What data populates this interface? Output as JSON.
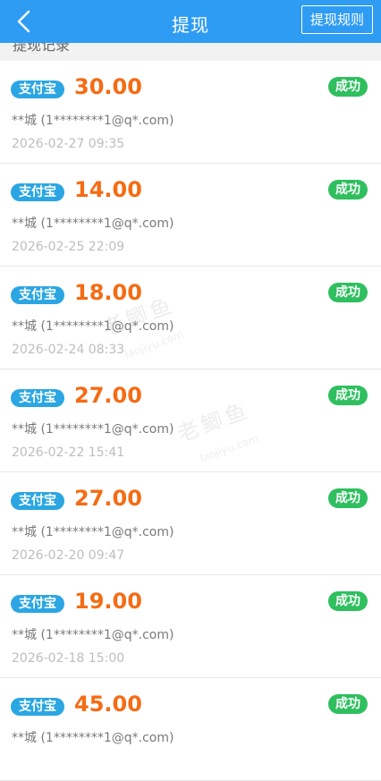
{
  "header": {
    "title": "提现",
    "rules_button": "提现规则"
  },
  "section": {
    "title": "提现记录"
  },
  "records": [
    {
      "method": "支付宝",
      "amount": "30.00",
      "status": "成功",
      "account": "**城 (1********1@q*.com)",
      "time": "2026-02-27 09:35"
    },
    {
      "method": "支付宝",
      "amount": "14.00",
      "status": "成功",
      "account": "**城 (1********1@q*.com)",
      "time": "2026-02-25 22:09"
    },
    {
      "method": "支付宝",
      "amount": "18.00",
      "status": "成功",
      "account": "**城 (1********1@q*.com)",
      "time": "2026-02-24 08:33"
    },
    {
      "method": "支付宝",
      "amount": "27.00",
      "status": "成功",
      "account": "**城 (1********1@q*.com)",
      "time": "2026-02-22 15:41"
    },
    {
      "method": "支付宝",
      "amount": "27.00",
      "status": "成功",
      "account": "**城 (1********1@q*.com)",
      "time": "2026-02-20 09:47"
    },
    {
      "method": "支付宝",
      "amount": "19.00",
      "status": "成功",
      "account": "**城 (1********1@q*.com)",
      "time": "2026-02-18 15:00"
    },
    {
      "method": "支付宝",
      "amount": "45.00",
      "status": "成功",
      "account": "**城 (1********1@q*.com)",
      "time": ""
    }
  ],
  "watermark": {
    "text": "老鲫鱼",
    "sub": "laojiyu.com"
  },
  "colors": {
    "header": "#2f9cf3",
    "alipay": "#2ba6e3",
    "amount": "#f46c14",
    "success": "#2fbf5f"
  },
  "icons": {
    "back": "chevron-left-icon"
  }
}
